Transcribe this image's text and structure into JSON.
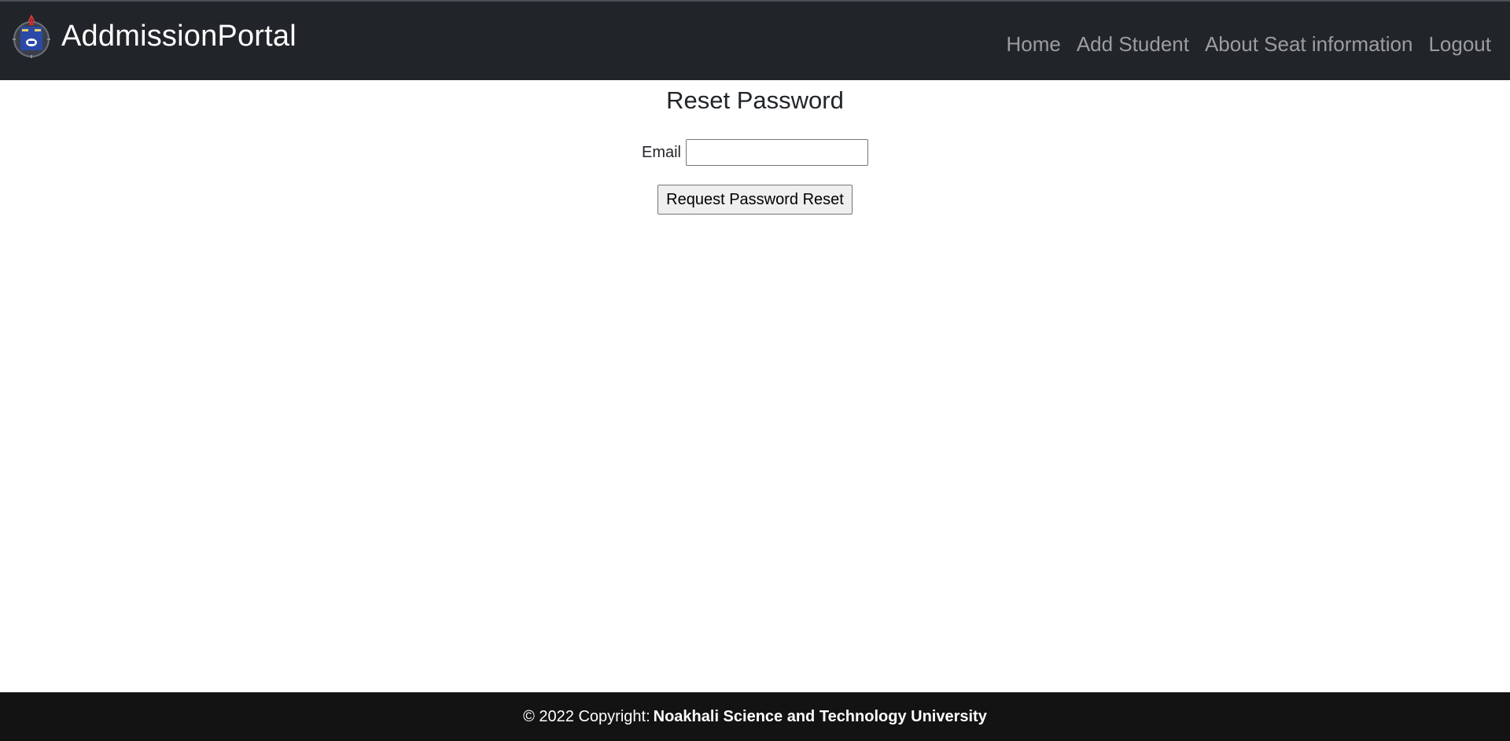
{
  "navbar": {
    "brand": "AddmissionPortal",
    "logo_icon": "university-crest-icon",
    "links": [
      {
        "label": "Home"
      },
      {
        "label": "Add Student"
      },
      {
        "label": "About Seat information"
      },
      {
        "label": "Logout"
      }
    ]
  },
  "form": {
    "title": "Reset Password",
    "email_label": "Email",
    "email_value": "",
    "submit_label": "Request Password Reset"
  },
  "footer": {
    "copyright": "© 2022 Copyright:",
    "organization": "Noakhali Science and Technology University"
  },
  "colors": {
    "navbar_bg": "#212529",
    "footer_bg": "#131313",
    "nav_link": "#8e9194",
    "text": "#212529"
  }
}
